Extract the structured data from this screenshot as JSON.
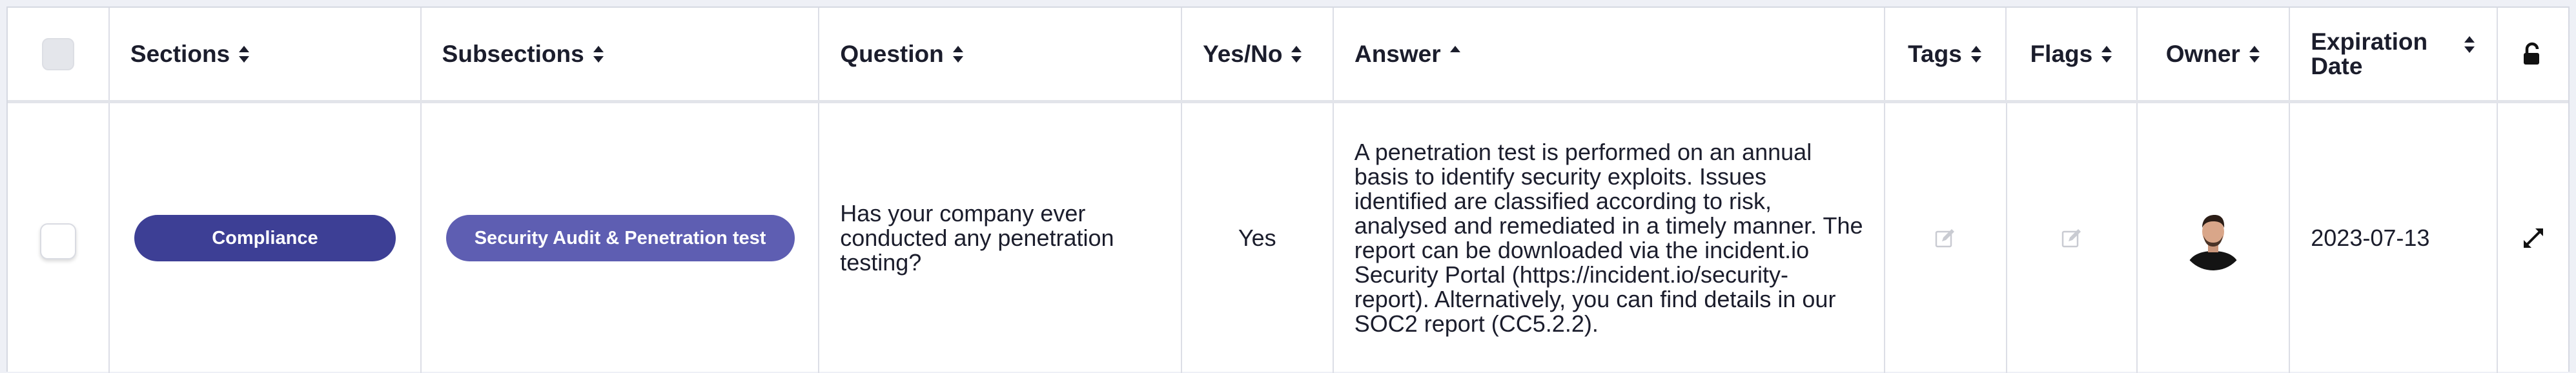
{
  "table": {
    "columns": [
      {
        "key": "select",
        "label": ""
      },
      {
        "key": "sections",
        "label": "Sections",
        "sort": "both"
      },
      {
        "key": "subsections",
        "label": "Subsections",
        "sort": "both"
      },
      {
        "key": "question",
        "label": "Question",
        "sort": "both"
      },
      {
        "key": "yesno",
        "label": "Yes/No",
        "sort": "both"
      },
      {
        "key": "answer",
        "label": "Answer",
        "sort": "asc"
      },
      {
        "key": "tags",
        "label": "Tags",
        "sort": "both"
      },
      {
        "key": "flags",
        "label": "Flags",
        "sort": "both"
      },
      {
        "key": "owner",
        "label": "Owner",
        "sort": "both"
      },
      {
        "key": "expiration",
        "label": "Expiration Date",
        "sort": "both"
      },
      {
        "key": "lock",
        "label": "",
        "icon": "unlock-icon"
      }
    ],
    "rows": [
      {
        "section": "Compliance",
        "subsection": "Security Audit & Penetration test",
        "question": "Has your company ever conducted any penetration testing?",
        "yes_no": "Yes",
        "answer": "A penetration test is performed on an annual basis to identify security exploits. Issues identified are classified according to risk, analysed and remediated in a timely manner. The report can be downloaded via the incident.io Security Portal (https://incident.io/security-report). Alternatively, you can find details in our SOC2 report (CC5.2.2).",
        "tags_icon": "edit-icon",
        "flags_icon": "edit-icon",
        "owner_icon": "avatar",
        "expiration_date": "2023-07-13",
        "action_icon": "expand-icon"
      }
    ]
  },
  "colors": {
    "section_pill": "#3d3f95",
    "subsection_pill": "#5e5eb2",
    "header_text": "#1b1d2c",
    "border": "#dcdee6"
  }
}
